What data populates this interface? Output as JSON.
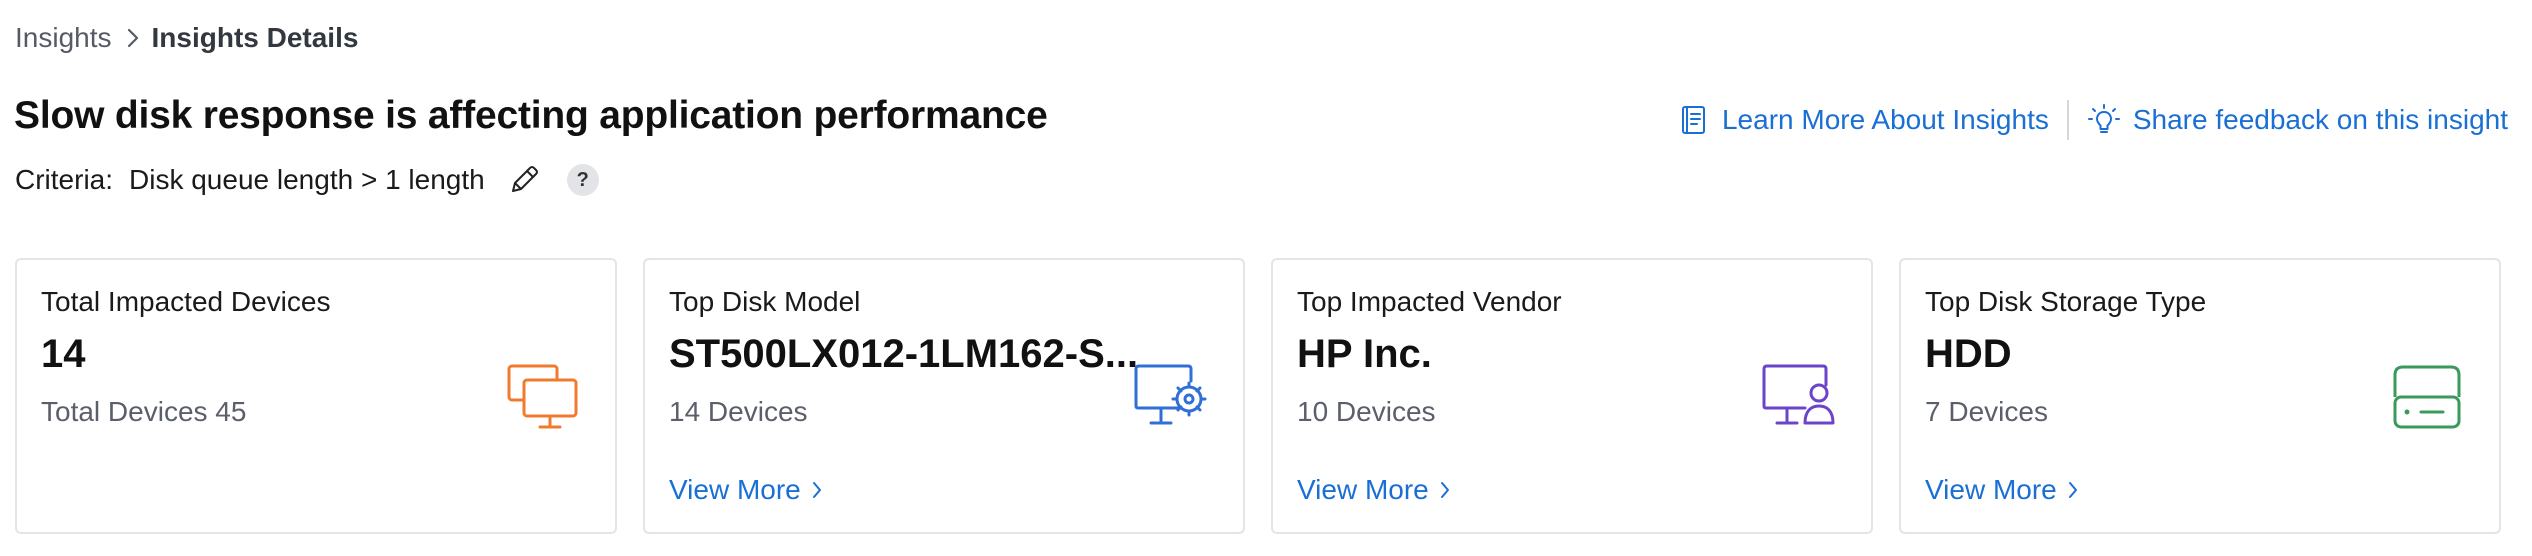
{
  "breadcrumb": {
    "items": [
      {
        "label": "Insights"
      },
      {
        "label": "Insights Details"
      }
    ]
  },
  "page": {
    "title": "Slow disk response is affecting application performance"
  },
  "criteria": {
    "label": "Criteria:",
    "value": "Disk queue length > 1 length",
    "help_glyph": "?"
  },
  "actions": {
    "learn_more": "Learn More About Insights",
    "feedback": "Share feedback on this insight"
  },
  "colors": {
    "link": "#1a6fd4",
    "orange": "#f07a2e",
    "blue": "#2f6fd6",
    "purple": "#6a45c9",
    "green": "#3a9a5c"
  },
  "cards": [
    {
      "title": "Total Impacted Devices",
      "value": "14",
      "sub": "Total Devices 45",
      "icon": "monitors-icon"
    },
    {
      "title": "Top Disk Model",
      "value": "ST500LX012-1LM162-S...",
      "sub": "14 Devices",
      "link": "View More",
      "icon": "monitor-gear-icon"
    },
    {
      "title": "Top Impacted Vendor",
      "value": "HP Inc.",
      "sub": "10 Devices",
      "link": "View More",
      "icon": "monitor-user-icon"
    },
    {
      "title": "Top Disk Storage Type",
      "value": "HDD",
      "sub": "7 Devices",
      "link": "View More",
      "icon": "hard-drive-icon"
    }
  ]
}
